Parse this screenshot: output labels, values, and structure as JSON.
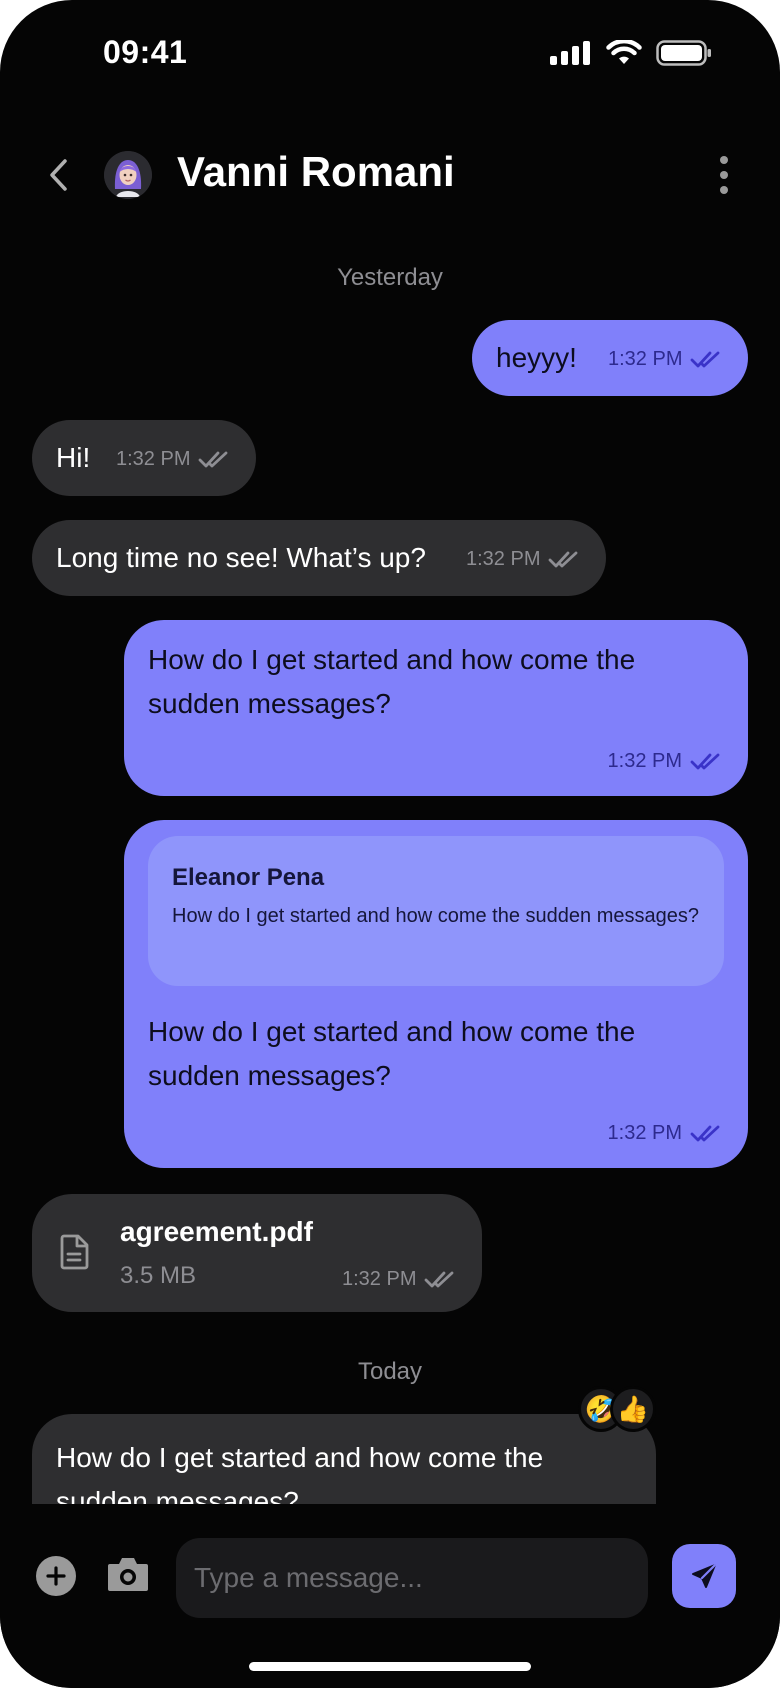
{
  "status_bar": {
    "time": "09:41",
    "icons": [
      "signal-icon",
      "wifi-icon",
      "battery-icon"
    ]
  },
  "header": {
    "contact_name": "Vanni Romani",
    "icons": [
      "back-arrow-icon",
      "avatar",
      "more-vertical-icon"
    ]
  },
  "days": {
    "yesterday": "Yesterday",
    "today": "Today"
  },
  "messages": [
    {
      "direction": "outgoing",
      "text": "heyyy!",
      "time": "1:32 PM",
      "status": "read"
    },
    {
      "direction": "incoming",
      "text": "Hi!",
      "time": "1:32 PM",
      "status": "read"
    },
    {
      "direction": "incoming",
      "text": "Long time no see! What’s up?",
      "time": "1:32 PM",
      "status": "read"
    },
    {
      "direction": "outgoing",
      "text": "How do I get started and how come the sudden messages?",
      "time": "1:32 PM",
      "status": "read"
    },
    {
      "direction": "outgoing",
      "reply_to": {
        "name": "Eleanor Pena",
        "text": "How do I get started and how come the sudden messages?"
      },
      "text": "How do I get started and how come the sudden messages?",
      "time": "1:32 PM",
      "status": "read"
    },
    {
      "direction": "incoming",
      "type": "file",
      "file_name": "agreement.pdf",
      "file_size": "3.5 MB",
      "time": "1:32 PM",
      "status": "read"
    },
    {
      "direction": "incoming",
      "text": "How do I get started and how come the sudden messages?",
      "reactions": [
        "🤣",
        "👍"
      ]
    }
  ],
  "composer": {
    "placeholder": "Type a message...",
    "icons": [
      "add-icon",
      "camera-icon",
      "send-icon"
    ]
  },
  "colors": {
    "background": "#050505",
    "outgoing_bubble": "#8080fa",
    "incoming_bubble": "#2e2e30",
    "quote_bubble": "#8f95fb",
    "read_check_outgoing": "#3a33c8",
    "meta_incoming": "#8e8e93"
  }
}
